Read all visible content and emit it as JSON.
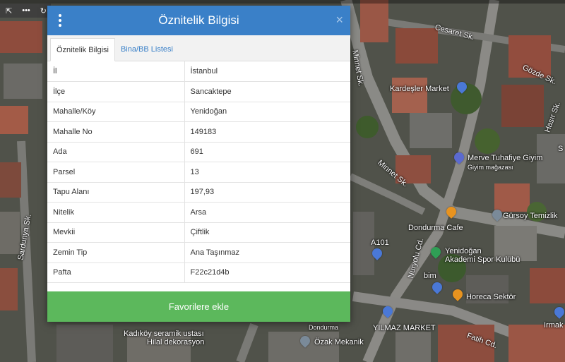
{
  "dialog": {
    "title": "Öznitelik Bilgisi",
    "close_icon": "×",
    "tabs": [
      {
        "label": "Öznitelik Bilgisi",
        "active": true
      },
      {
        "label": "Bina/BB Listesi",
        "active": false
      }
    ],
    "rows": [
      {
        "key": "İl",
        "value": "İstanbul"
      },
      {
        "key": "İlçe",
        "value": "Sancaktepe"
      },
      {
        "key": "Mahalle/Köy",
        "value": "Yenidoğan"
      },
      {
        "key": "Mahalle No",
        "value": "149183"
      },
      {
        "key": "Ada",
        "value": "691"
      },
      {
        "key": "Parsel",
        "value": "13"
      },
      {
        "key": "Tapu Alanı",
        "value": "197,93"
      },
      {
        "key": "Nitelik",
        "value": "Arsa"
      },
      {
        "key": "Mevkii",
        "value": "Çiftlik"
      },
      {
        "key": "Zemin Tip",
        "value": "Ana Taşınmaz"
      },
      {
        "key": "Pafta",
        "value": "F22c21d4b"
      }
    ],
    "favorite_button": "Favorilere ekle"
  },
  "map": {
    "toolbar": {
      "item1": "⇱",
      "item2": "•••",
      "item3": "↻"
    },
    "labels": {
      "cesaret": "Cesaret Sk.",
      "minnet_top": "Minnet Sk.",
      "gozde": "Gözde Sk.",
      "kardesler": "Kardeşler Market",
      "hasir": "Hasır Sk.",
      "merve": "Merve Tuhafiye Giyim",
      "merve_sub": "Giyim mağazası",
      "minnet_mid": "Minnet Sk.",
      "gursoy": "Gürsoy Temizlik",
      "dondurma_cafe": "Dondurma Cafe",
      "a101": "A101",
      "yenidogan": "Yenidoğan",
      "akademi": "Akademi Spor Kulübü",
      "nuryolu": "Nuryolu Cd.",
      "bim": "bim",
      "horeca": "Horeca Sektör",
      "sardunya": "Sardunya Sk.",
      "kadikoy": "Kadıköy seramik ustası",
      "hilal": "Hilal dekorasyon",
      "dondurma2": "Dondurma",
      "yilmaz": "YILMAZ MARKET",
      "ozak": "Özak Mekanik",
      "fatih": "Fatih Cd.",
      "s_right": "S",
      "irmak": "Irmak"
    }
  }
}
